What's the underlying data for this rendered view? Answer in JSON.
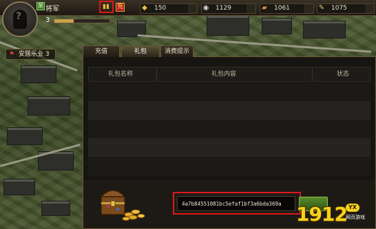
{
  "player": {
    "name": "将军",
    "vip_badge": "荣",
    "level": "3",
    "xp_progress": 0.35
  },
  "topbar": {
    "icon_gift": "gift-icon",
    "recharge_label": "充",
    "resources": [
      {
        "icon": "gold-ingot-icon",
        "glyph": "◆",
        "value": "150"
      },
      {
        "icon": "silver-icon",
        "glyph": "◉",
        "value": "1129"
      },
      {
        "icon": "copper-icon",
        "glyph": "▰",
        "value": "1061"
      },
      {
        "icon": "scroll-icon",
        "glyph": "✎",
        "value": "1075"
      }
    ]
  },
  "location": {
    "label": "安居乐业 3"
  },
  "tabs": [
    {
      "label": "充值",
      "active": false
    },
    {
      "label": "礼包",
      "active": true
    },
    {
      "label": "消费提示",
      "active": false
    }
  ],
  "table": {
    "headers": [
      "礼包名称",
      "礼包内容",
      "状态"
    ],
    "row_count": 5
  },
  "redeem": {
    "code": "4a7b84551081bc5efaf1bf3a6bda369a"
  },
  "watermark": {
    "number": "1912",
    "badge": "YX",
    "subtitle": "网页游戏"
  },
  "colors": {
    "highlight": "#e01818",
    "gold": "#f6d21c"
  }
}
